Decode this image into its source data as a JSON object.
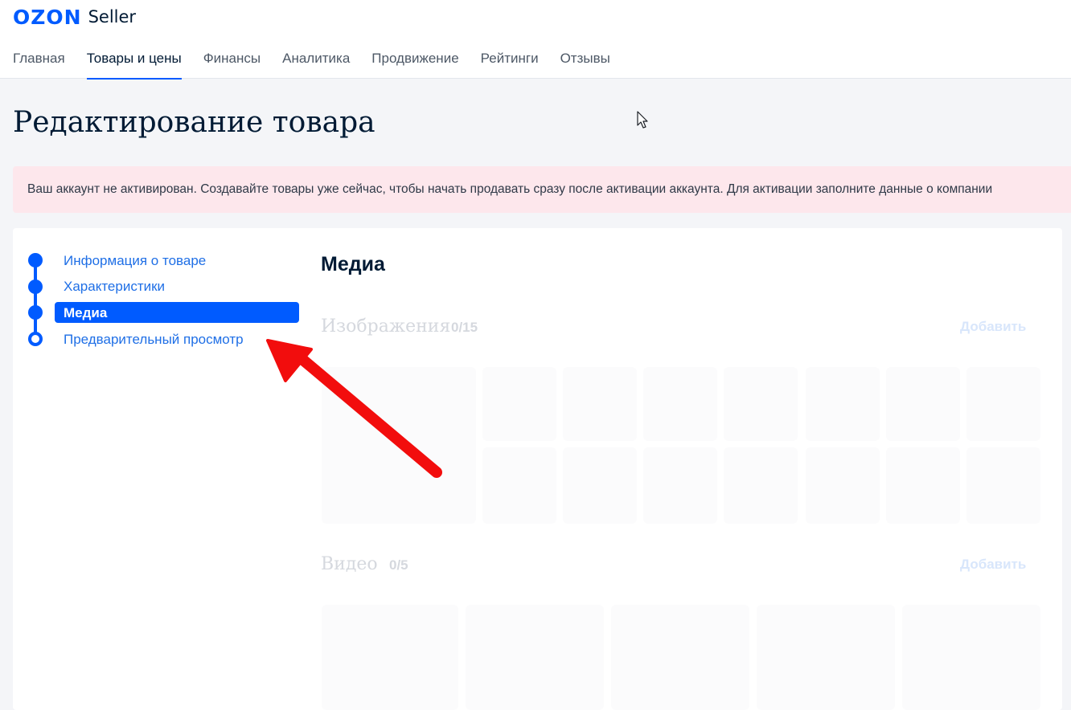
{
  "logo": {
    "brand": "OZON",
    "product": "Seller"
  },
  "nav": [
    {
      "label": "Главная",
      "active": false
    },
    {
      "label": "Товары и цены",
      "active": true
    },
    {
      "label": "Финансы",
      "active": false
    },
    {
      "label": "Аналитика",
      "active": false
    },
    {
      "label": "Продвижение",
      "active": false
    },
    {
      "label": "Рейтинги",
      "active": false
    },
    {
      "label": "Отзывы",
      "active": false
    }
  ],
  "page_title": "Редактирование товара",
  "alert": {
    "text": "Ваш аккаунт не активирован. Создавайте товары уже сейчас, чтобы начать продавать сразу после активации аккаунта. Для активации заполните данные о компании"
  },
  "steps": [
    {
      "label": "Информация о товаре"
    },
    {
      "label": "Характеристики"
    },
    {
      "label": "Медиа",
      "active": true
    },
    {
      "label": "Предварительный просмотр"
    }
  ],
  "media": {
    "title": "Медиа",
    "images": {
      "label": "Изображения",
      "count": "0/15",
      "add_label": "Добавить"
    },
    "video": {
      "label": "Видео",
      "count": "0/5",
      "add_label": "Добавить"
    }
  },
  "colors": {
    "brand": "#005bff",
    "alert_bg": "#fde7ec",
    "annotation_arrow": "#f20d0d"
  }
}
